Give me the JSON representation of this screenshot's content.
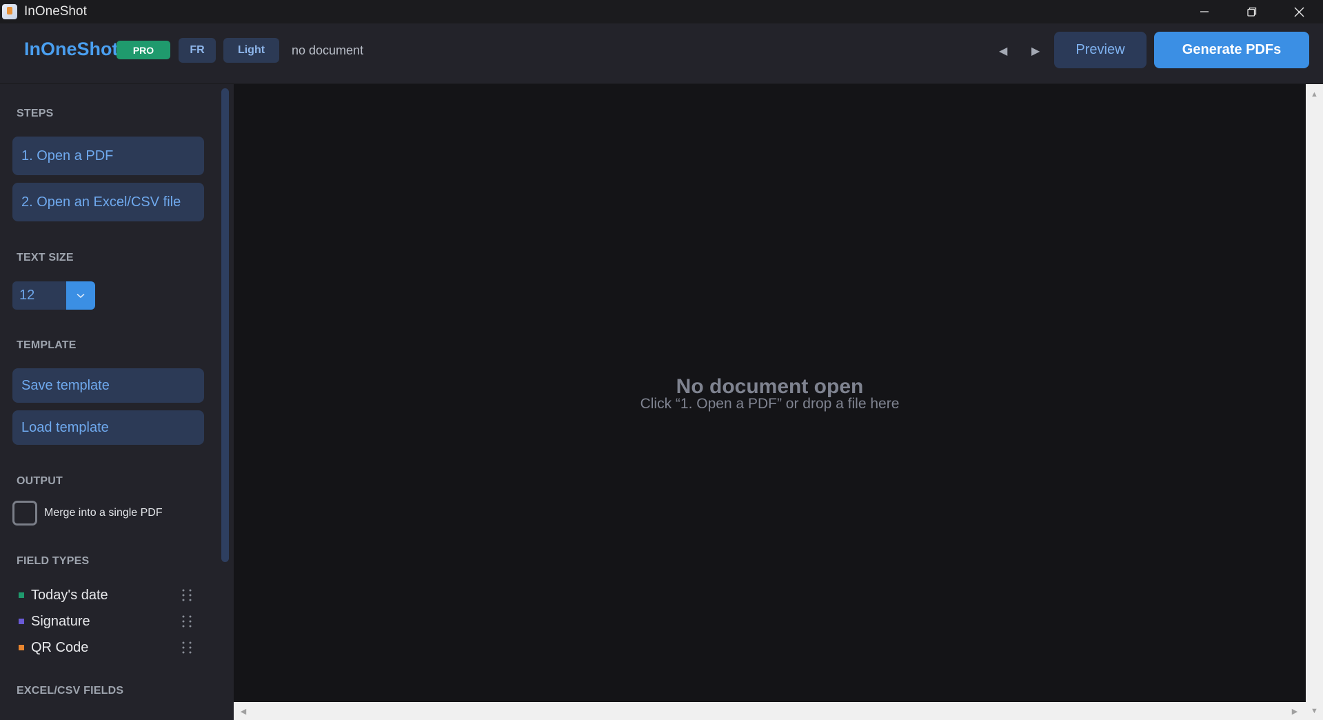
{
  "window": {
    "title": "InOneShot",
    "controls": {
      "minimize_icon": "minimize-icon",
      "maximize_icon": "restore-icon",
      "close_icon": "close-icon"
    }
  },
  "header": {
    "brand": "InOneShot",
    "badge": "PRO",
    "language_toggle": "FR",
    "theme_toggle": "Light",
    "document_status": "no document",
    "prev_arrow": "◀",
    "next_arrow": "▶",
    "preview_label": "Preview",
    "generate_label": "Generate PDFs"
  },
  "sidebar": {
    "steps": {
      "title": "STEPS",
      "items": [
        "1.  Open a PDF",
        "2.  Open an Excel/CSV file"
      ]
    },
    "text_size": {
      "title": "TEXT SIZE",
      "value": "12"
    },
    "template": {
      "title": "TEMPLATE",
      "save_label": "Save template",
      "load_label": "Load template"
    },
    "output": {
      "title": "OUTPUT",
      "merge_label": "Merge into a single PDF",
      "merge_checked": false
    },
    "field_types": {
      "title": "FIELD TYPES",
      "items": [
        {
          "label": "Today's date",
          "color": "#1f9a6d"
        },
        {
          "label": "Signature",
          "color": "#6a5ad6"
        },
        {
          "label": "QR Code",
          "color": "#e8852f"
        }
      ]
    },
    "excel_fields": {
      "title": "EXCEL/CSV FIELDS"
    }
  },
  "canvas": {
    "empty_title": "No document open",
    "empty_subtitle": "Click “1. Open a PDF” or drop a file here"
  },
  "colors": {
    "accent": "#3b8fe4",
    "brand": "#4a9ff0",
    "pro_badge": "#1f9a6d"
  }
}
